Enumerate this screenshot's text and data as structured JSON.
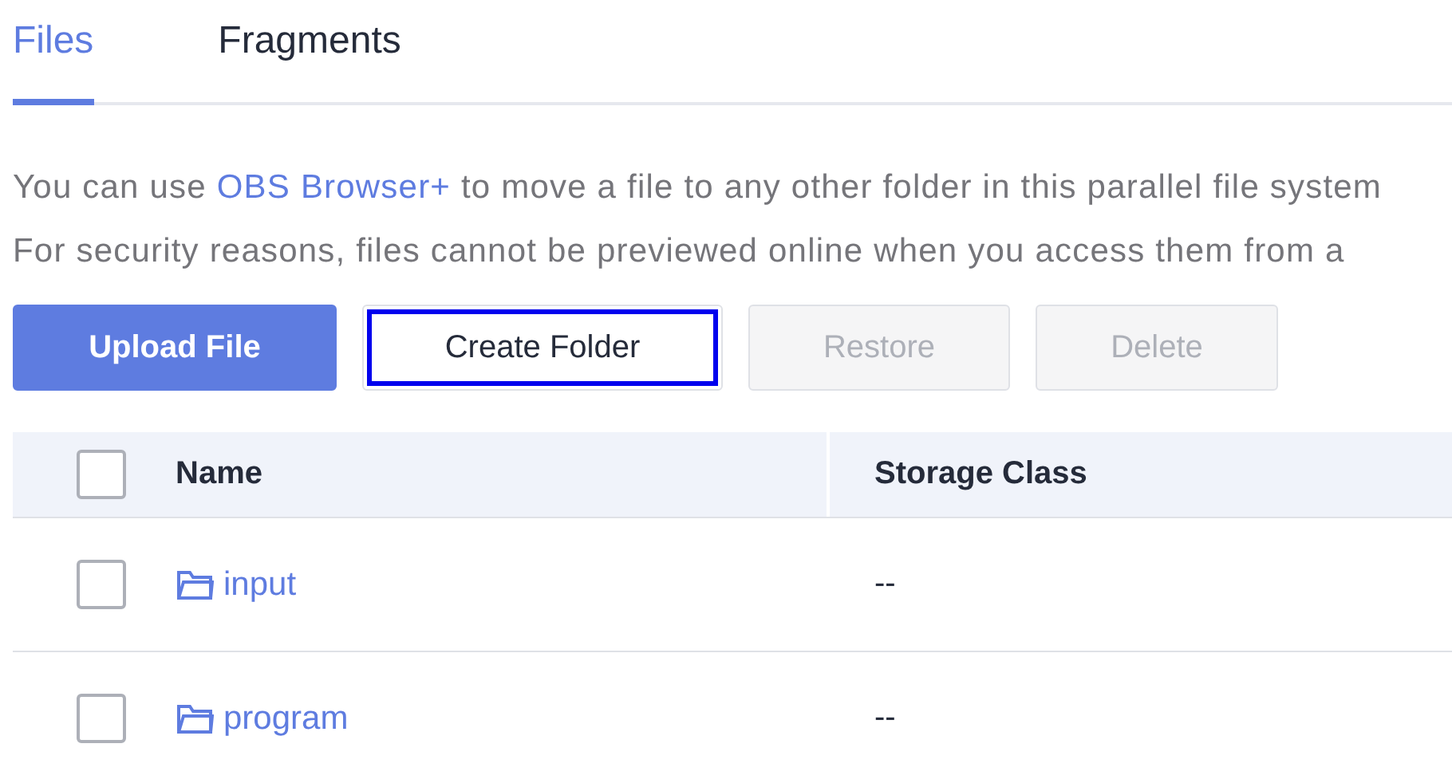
{
  "tabs": [
    {
      "label": "Files",
      "selected": true
    },
    {
      "label": "Fragments",
      "selected": false
    }
  ],
  "notices": [
    {
      "before": "You can use ",
      "link": "OBS Browser+",
      "after": " to move a file to any other folder in this parallel file system"
    },
    {
      "before": "For security reasons, files cannot be previewed online when you access them from a"
    }
  ],
  "buttons": [
    {
      "label": "Upload File",
      "kind": "primary",
      "disabled": false,
      "focused": false
    },
    {
      "label": "Create Folder",
      "kind": "default",
      "disabled": false,
      "focused": true
    },
    {
      "label": "Restore",
      "kind": "default",
      "disabled": true,
      "focused": false
    },
    {
      "label": "Delete",
      "kind": "default",
      "disabled": true,
      "focused": false
    }
  ],
  "table": {
    "header_checked": false,
    "columns": [
      "Name",
      "Storage Class"
    ],
    "rows": [
      {
        "checked": false,
        "name": "input",
        "storage_class": "--"
      },
      {
        "checked": false,
        "name": "program",
        "storage_class": "--"
      }
    ]
  }
}
